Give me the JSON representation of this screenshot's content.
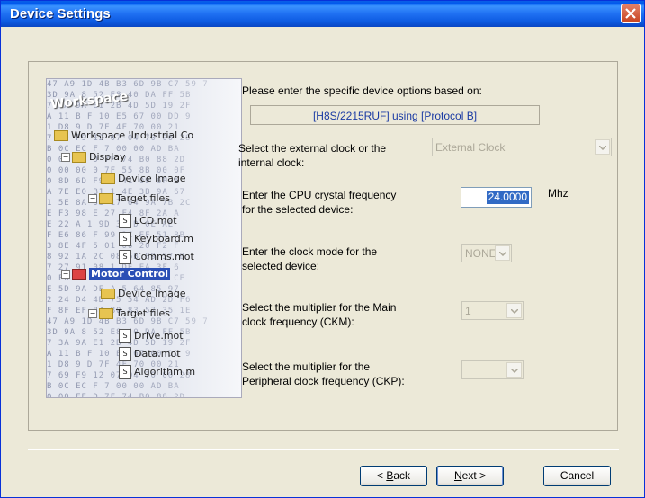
{
  "window": {
    "title": "Device Settings"
  },
  "illustration": {
    "workspace_label": "Workspace",
    "hex_rows": [
      "47 A9 1D 4B B3 6D 9B C7 59 7",
      "3D 9A 8 52 E8 40 DA FF 5B",
      "7 3A 9A E1 2B 4D 5D 19 2F",
      "A 11 B F 10 E5 67 00 DD 9",
      "1 D8 9 D 7F 4F 70 00 21",
      "7 69 F9 12 07 04 70 00 28",
      "B 0C EC F 7 00 00 AD BA",
      "0 00 FE D 7F 74 B0 88 2D",
      "0 00 00 0 7F 55 8B 00 0F",
      "0 8D 6D F9 9 41 09 6F A",
      "A 7E E0 B1 1 4E 3B 9A 67",
      "1 5E 8A 33 17 64 9A 7B 2C",
      "E F3 98 E 27 F4 8F 2A A",
      "E 22 A 1 9D 35 D 0E AE",
      "F E6 86 F 99 3C EF 51 8B",
      "3 8E 4F 5 01 06 20 F2 F",
      "8 92 1A 2C 08 6B 89 57 B",
      "7 27 91 08 1 DE EA 3F 6",
      "0 F0 58 FD 5 09 68 D9 CE",
      "E 5D 9A DE A 5 64 85 97",
      "2 24 D4 4D 75 54 AD 2D F6",
      "F 8F EF 84 B0 83 57 35 1E"
    ],
    "tree": {
      "workspace": "Workspace 'Industrial Co",
      "display": "Display",
      "device_image_1": "Device Image",
      "target_files_1": "Target files",
      "lcd": "LCD.mot",
      "keyboard": "Keyboard.m",
      "comms": "Comms.mot",
      "motor_control": "Motor Control",
      "device_image_2": "Device Image",
      "target_files_2": "Target files",
      "drive": "Drive.mot",
      "data": "Data.mot",
      "algorithm": "Algorithm.m"
    }
  },
  "intro": "Please enter the specific device options based on:",
  "device_info": "[H8S/2215RUF]  using  [Protocol B]",
  "clock_source": {
    "label_line1": "Select the external clock or the",
    "label_line2": "internal clock:",
    "value": "External Clock"
  },
  "cpu_freq": {
    "label_line1": "Enter the CPU crystal frequency",
    "label_line2": "for the selected device:",
    "value": "24.0000",
    "unit": "Mhz"
  },
  "clock_mode": {
    "label_line1": "Enter the clock mode for the",
    "label_line2": "selected device:",
    "value": "NONE"
  },
  "ckm": {
    "label_line1": "Select the multiplier for the Main",
    "label_line2": "clock frequency (CKM):",
    "value": "1"
  },
  "ckp": {
    "label_line1": "Select the multiplier for the",
    "label_line2": "Peripheral clock frequency (CKP):",
    "value": ""
  },
  "buttons": {
    "back_prefix": "< ",
    "back_key": "B",
    "back_rest": "ack",
    "next_key": "N",
    "next_rest": "ext >",
    "cancel": "Cancel"
  },
  "colors": {
    "title_bar": "#0058ee",
    "close": "#c8431f",
    "dialog_bg": "#ece9d8",
    "selection": "#316ac5",
    "device_info_text": "#1a3aa3"
  }
}
